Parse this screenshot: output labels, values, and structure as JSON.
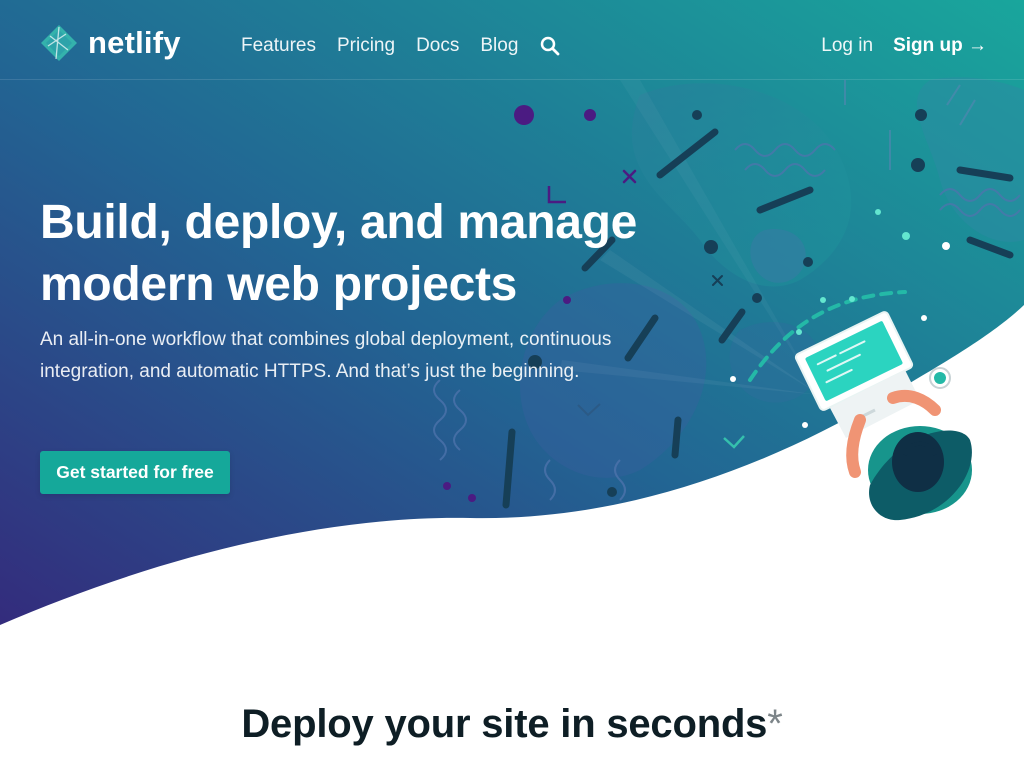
{
  "header": {
    "logo_text": "netlify",
    "nav": [
      {
        "label": "Features"
      },
      {
        "label": "Pricing"
      },
      {
        "label": "Docs"
      },
      {
        "label": "Blog"
      }
    ],
    "search_icon": "search-icon",
    "login_label": "Log in",
    "signup_label": "Sign up →"
  },
  "hero": {
    "headline": "Build, deploy, and manage modern web projects",
    "lede": "An all-in-one workflow that combines global deployment, continuous integration, and automatic HTTPS. And that’s just the beginning.",
    "cta_label": "Get started for free",
    "illustration": "person-with-laptop-illustration"
  },
  "section": {
    "title": "Deploy your site in seconds",
    "title_mark": "*"
  },
  "colors": {
    "gradient_start": "#2f2a78",
    "gradient_mid": "#21698f",
    "gradient_end": "#1da49b",
    "cta": "#15a89a",
    "title_text": "#0e1e25"
  }
}
